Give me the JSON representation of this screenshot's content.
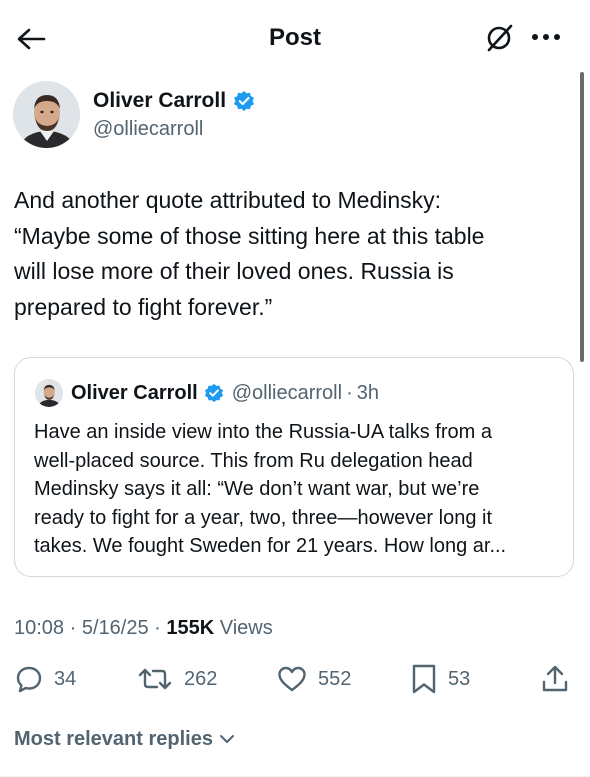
{
  "header": {
    "title": "Post",
    "back_icon": "arrow-left-icon",
    "grok_icon": "grok-icon",
    "more_icon": "more-horizontal-icon"
  },
  "author": {
    "name": "Oliver Carroll",
    "handle": "@olliecarroll",
    "verified": true,
    "verified_color": "#1d9bf0"
  },
  "tweet": {
    "lines": [
      "And another quote attributed to Medinsky:",
      "“Maybe some of those sitting here at this table",
      "will lose more of their loved ones. Russia is",
      "prepared to fight forever.”"
    ]
  },
  "quote": {
    "name": "Oliver Carroll",
    "handle": "@olliecarroll",
    "dot": "·",
    "time": "3h",
    "lines": [
      "Have an inside view into the Russia-UA talks from a",
      "well-placed source. This from Ru delegation head",
      "Medinsky says it all: “We don’t want war, but we’re",
      "ready to fight for a year, two, three—however long it",
      "takes. We fought Sweden for 21 years. How long ar..."
    ]
  },
  "meta": {
    "time": "10:08",
    "sep1": " · ",
    "date": "5/16/25",
    "sep2": " · ",
    "views_count": "155K",
    "views_label": " Views"
  },
  "actions": {
    "replies": "34",
    "reposts": "262",
    "likes": "552",
    "bookmarks": "53"
  },
  "replies_filter": {
    "label": "Most relevant replies"
  },
  "colors": {
    "text": "#0f1419",
    "secondary": "#536471",
    "accent": "#1d9bf0",
    "border": "#cfd9de"
  }
}
